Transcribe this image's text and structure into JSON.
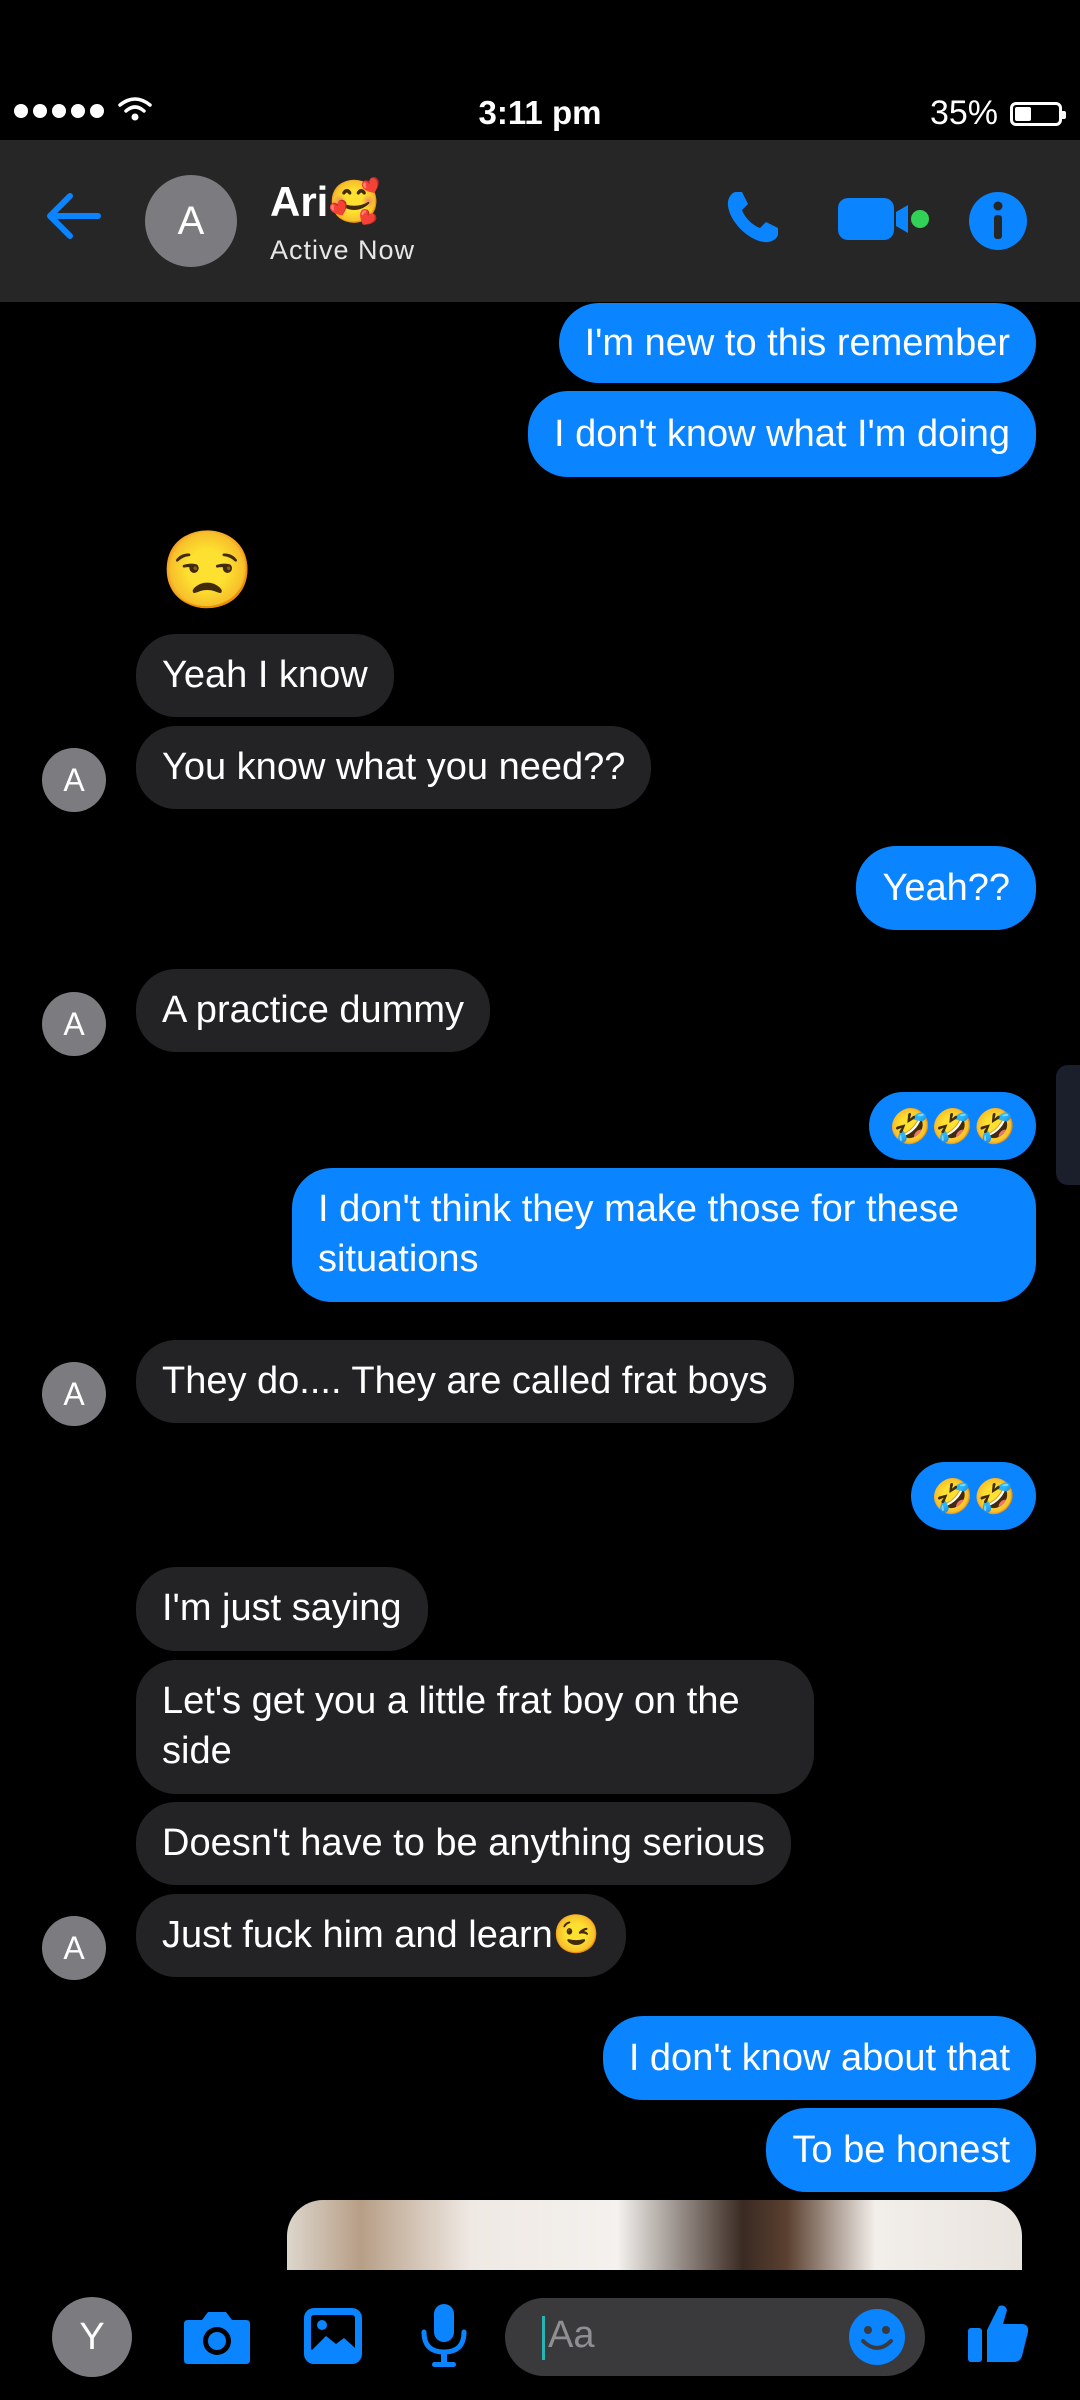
{
  "status_bar": {
    "time": "3:11 pm",
    "battery": "35%",
    "battery_level": 0.35
  },
  "header": {
    "contact_initial": "A",
    "contact_name": "Ari🥰",
    "contact_status": "Active Now",
    "icons": [
      "back-arrow-icon",
      "phone-icon",
      "video-icon",
      "info-icon"
    ]
  },
  "big_emoji": "😒",
  "messages": [
    {
      "dir": "out",
      "text": "I'm new to this remember"
    },
    {
      "dir": "out",
      "text": "I don't know what I'm doing"
    },
    {
      "dir": "in",
      "text": "Yeah I know"
    },
    {
      "dir": "in",
      "text": "You know what you need??",
      "avatar": "A"
    },
    {
      "dir": "out",
      "text": "Yeah??"
    },
    {
      "dir": "in",
      "text": "A practice dummy",
      "avatar": "A"
    },
    {
      "dir": "out",
      "text": "🤣🤣🤣"
    },
    {
      "dir": "out",
      "text": "I don't think they make those for these situations"
    },
    {
      "dir": "in",
      "text": "They do.... They are called frat boys",
      "avatar": "A"
    },
    {
      "dir": "out",
      "text": "🤣🤣"
    },
    {
      "dir": "in",
      "text": "I'm just saying"
    },
    {
      "dir": "in",
      "text": "Let's get you a little frat boy on the side"
    },
    {
      "dir": "in",
      "text": "Doesn't have to be anything serious"
    },
    {
      "dir": "in",
      "text": "Just fuck him and learn😉",
      "avatar": "A"
    },
    {
      "dir": "out",
      "text": "I don't know about that"
    },
    {
      "dir": "out",
      "text": "To be honest"
    }
  ],
  "composer": {
    "user_initial": "Y",
    "placeholder": "Aa",
    "icons": [
      "camera-icon",
      "gallery-icon",
      "microphone-icon",
      "emoji-icon",
      "thumbs-up-icon"
    ]
  },
  "colors": {
    "outgoing": "#0a84ff",
    "incoming": "#232326",
    "accent": "#0a84ff",
    "video_active": "#31d158"
  }
}
